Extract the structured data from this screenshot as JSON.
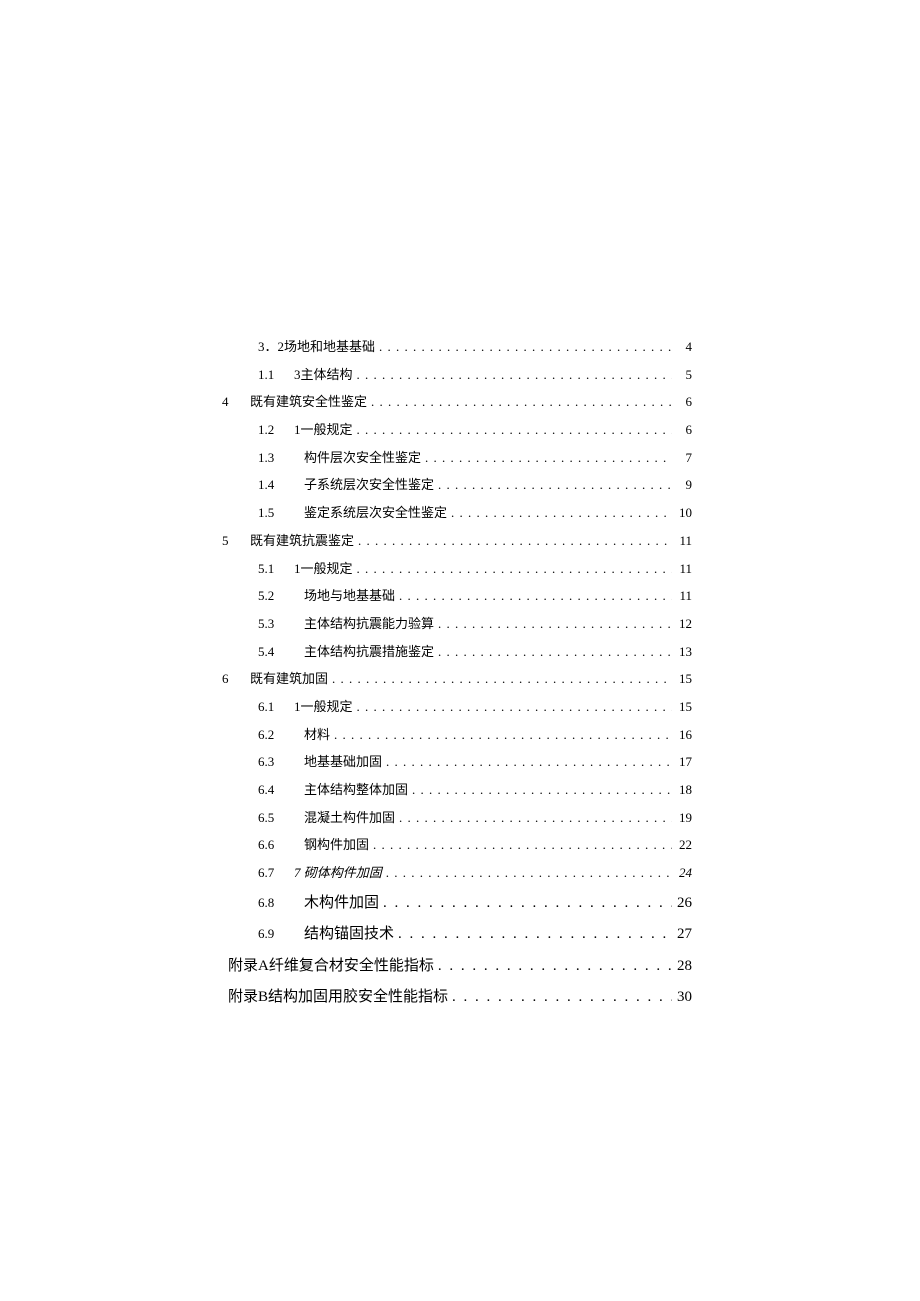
{
  "toc": {
    "e32": {
      "num": "",
      "label": "3．2场地和地基基础",
      "page": "4"
    },
    "e11": {
      "num": "1.1",
      "label": "3主体结构",
      "page": "5"
    },
    "ch4": {
      "num": "4",
      "label": "既有建筑安全性鉴定",
      "page": "6"
    },
    "e12": {
      "num": "1.2",
      "label": "1一般规定",
      "page": "6"
    },
    "e13": {
      "num": "1.3",
      "label": "构件层次安全性鉴定",
      "page": "7"
    },
    "e14": {
      "num": "1.4",
      "label": "子系统层次安全性鉴定",
      "page": "9"
    },
    "e15": {
      "num": "1.5",
      "label": "鉴定系统层次安全性鉴定",
      "page": "10"
    },
    "ch5": {
      "num": "5",
      "label": "既有建筑抗震鉴定",
      "page": "11"
    },
    "e51": {
      "num": "5.1",
      "label": "1一般规定",
      "page": "11"
    },
    "e52": {
      "num": "5.2",
      "label": "场地与地基基础",
      "page": "11"
    },
    "e53": {
      "num": "5.3",
      "label": "主体结构抗震能力验算",
      "page": "12"
    },
    "e54": {
      "num": "5.4",
      "label": "主体结构抗震措施鉴定",
      "page": "13"
    },
    "ch6": {
      "num": "6",
      "label": "既有建筑加固",
      "page": "15"
    },
    "e61": {
      "num": "6.1",
      "label": "1一般规定",
      "page": "15"
    },
    "e62": {
      "num": "6.2",
      "label": "材料",
      "page": "16"
    },
    "e63": {
      "num": "6.3",
      "label": "地基基础加固",
      "page": "17"
    },
    "e64": {
      "num": "6.4",
      "label": "主体结构整体加固",
      "page": "18"
    },
    "e65": {
      "num": "6.5",
      "label": "混凝土构件加固",
      "page": "19"
    },
    "e66": {
      "num": "6.6",
      "label": "钢构件加固",
      "page": "22"
    },
    "e67": {
      "num": "6.7",
      "label": "7 砌体构件加固",
      "page": "24"
    },
    "e68": {
      "num": "6.8",
      "label": "木构件加固",
      "page": "26"
    },
    "e69": {
      "num": "6.9",
      "label": "结构锚固技术",
      "page": "27"
    },
    "appA": {
      "num": "",
      "label": "附录A纤维复合材安全性能指标",
      "page": "28"
    },
    "appB": {
      "num": "",
      "label": "附录B结构加固用胶安全性能指标",
      "page": "30"
    }
  }
}
